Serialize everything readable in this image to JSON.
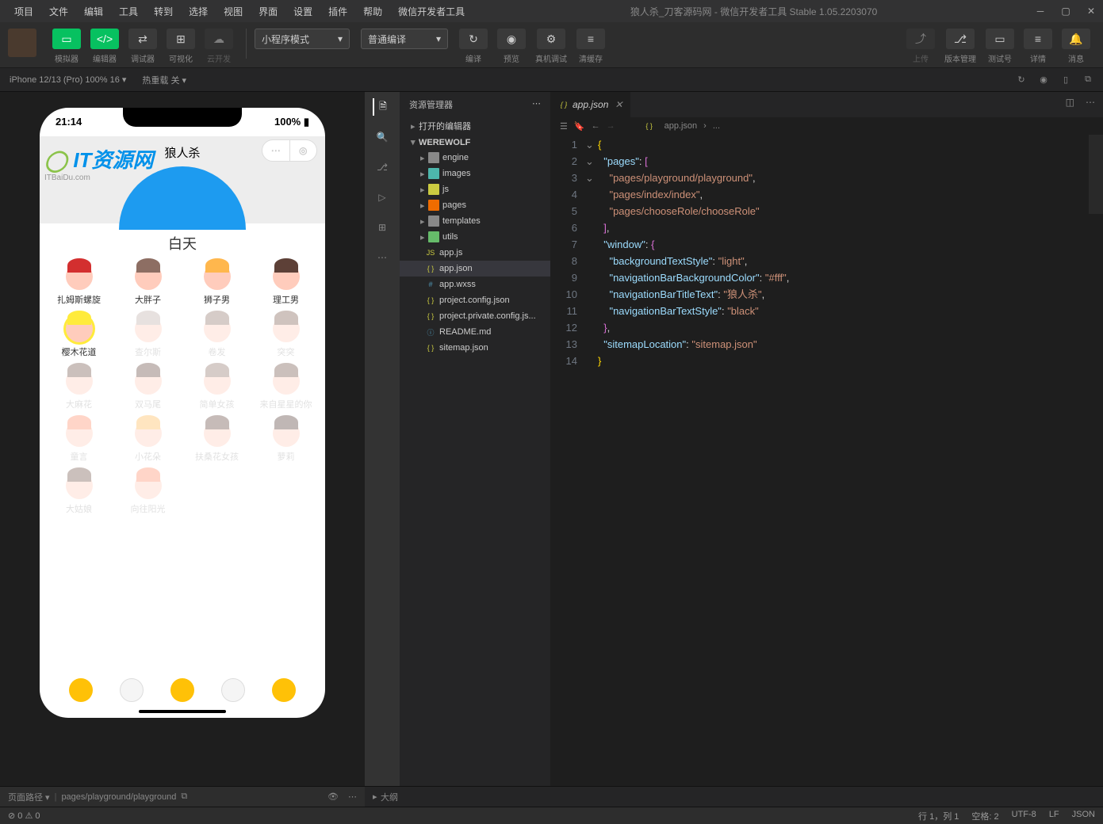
{
  "menu": [
    "项目",
    "文件",
    "编辑",
    "工具",
    "转到",
    "选择",
    "视图",
    "界面",
    "设置",
    "插件",
    "帮助",
    "微信开发者工具"
  ],
  "title": "狼人杀_刀客源码网 - 微信开发者工具 Stable 1.05.2203070",
  "toolbar": {
    "simulator": "模拟器",
    "editor": "编辑器",
    "debugger": "调试器",
    "visualizer": "可视化",
    "cloud": "云开发",
    "mode": "小程序模式",
    "compile_mode": "普通编译",
    "compile": "编译",
    "preview": "预览",
    "remote_debug": "真机调试",
    "clear_cache": "清缓存",
    "upload": "上传",
    "version": "版本管理",
    "test": "测试号",
    "details": "详情",
    "notify": "消息"
  },
  "device_bar": {
    "device": "iPhone 12/13 (Pro) 100% 16 ▾",
    "reload": "热重载 关 ▾"
  },
  "phone": {
    "time": "21:14",
    "battery": "100%",
    "app_title": "狼人杀",
    "watermark": "IT资源网",
    "watermark_sub": "ITBaiDu.com",
    "hero_label": "白天",
    "roles_row1": [
      "扎姆斯螺旋",
      "大胖子",
      "狮子男",
      "理工男"
    ],
    "roles_row2": [
      "樱木花道",
      "查尔斯",
      "卷发",
      "突突"
    ],
    "roles_row3": [
      "大麻花",
      "双马尾",
      "简单女孩",
      "来自星星的你"
    ],
    "roles_row4": [
      "童言",
      "小花朵",
      "扶桑花女孩",
      "萝莉"
    ],
    "roles_row5": [
      "大姑娘",
      "向往阳光"
    ]
  },
  "explorer": {
    "title": "资源管理器",
    "open_editors": "打开的编辑器",
    "project": "WEREWOLF",
    "folders": [
      "engine",
      "images",
      "js",
      "pages",
      "templates",
      "utils"
    ],
    "files": [
      "app.js",
      "app.json",
      "app.wxss",
      "project.config.json",
      "project.private.config.js...",
      "README.md",
      "sitemap.json"
    ],
    "outline": "大纲"
  },
  "editor_tab": "app.json",
  "breadcrumb": [
    "app.json",
    "..."
  ],
  "code_lines": [
    {
      "n": 1,
      "html": "<span class='s-br'>{</span>"
    },
    {
      "n": 2,
      "html": "  <span class='s-key'>\"pages\"</span><span class='s-punc'>:</span> <span class='s-br2'>[</span>"
    },
    {
      "n": 3,
      "html": "    <span class='s-str'>\"pages/playground/playground\"</span><span class='s-punc'>,</span>"
    },
    {
      "n": 4,
      "html": "    <span class='s-str'>\"pages/index/index\"</span><span class='s-punc'>,</span>"
    },
    {
      "n": 5,
      "html": "    <span class='s-str'>\"pages/chooseRole/chooseRole\"</span>"
    },
    {
      "n": 6,
      "html": "  <span class='s-br2'>]</span><span class='s-punc'>,</span>"
    },
    {
      "n": 7,
      "html": "  <span class='s-key'>\"window\"</span><span class='s-punc'>:</span> <span class='s-br2'>{</span>"
    },
    {
      "n": 8,
      "html": "    <span class='s-key'>\"backgroundTextStyle\"</span><span class='s-punc'>:</span> <span class='s-str'>\"light\"</span><span class='s-punc'>,</span>"
    },
    {
      "n": 9,
      "html": "    <span class='s-key'>\"navigationBarBackgroundColor\"</span><span class='s-punc'>:</span> <span class='s-str'>\"#fff\"</span><span class='s-punc'>,</span>"
    },
    {
      "n": 10,
      "html": "    <span class='s-key'>\"navigationBarTitleText\"</span><span class='s-punc'>:</span> <span class='s-str'>\"狼人杀\"</span><span class='s-punc'>,</span>"
    },
    {
      "n": 11,
      "html": "    <span class='s-key'>\"navigationBarTextStyle\"</span><span class='s-punc'>:</span> <span class='s-str'>\"black\"</span>"
    },
    {
      "n": 12,
      "html": "  <span class='s-br2'>}</span><span class='s-punc'>,</span>"
    },
    {
      "n": 13,
      "html": "  <span class='s-key'>\"sitemapLocation\"</span><span class='s-punc'>:</span> <span class='s-str'>\"sitemap.json\"</span>"
    },
    {
      "n": 14,
      "html": "<span class='s-br'>}</span>"
    }
  ],
  "pathbar": {
    "label": "页面路径 ▾",
    "path": "pages/playground/playground"
  },
  "outline_err": "⊘ 0 ⚠ 0",
  "status": {
    "pos": "行 1，列 1",
    "spaces": "空格: 2",
    "enc": "UTF-8",
    "eol": "LF",
    "lang": "JSON"
  }
}
